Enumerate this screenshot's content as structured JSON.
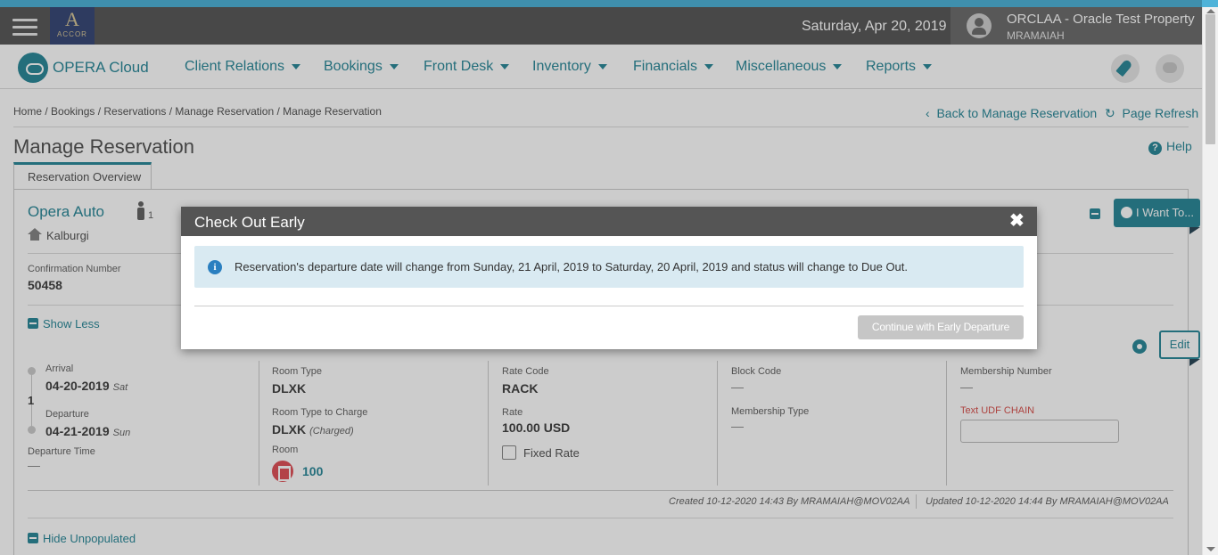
{
  "header": {
    "brand_logo_letter": "A",
    "brand_logo_text": "ACCOR",
    "date": "Saturday, Apr 20, 2019",
    "property_name": "ORCLAA - Oracle Test Property",
    "user": "MRAMAIAH"
  },
  "nav": {
    "app_name": "OPERA Cloud",
    "items": [
      "Client Relations",
      "Bookings",
      "Front Desk",
      "Inventory",
      "Financials",
      "Miscellaneous",
      "Reports"
    ]
  },
  "breadcrumb": "Home / Bookings / Reservations / Manage Reservation / Manage Reservation",
  "links": {
    "back": "Back to Manage Reservation",
    "refresh": "Page Refresh",
    "help": "Help"
  },
  "page_title": "Manage Reservation",
  "tab_label": "Reservation Overview",
  "guest": {
    "name": "Opera Auto",
    "persons": "1",
    "city": "Kalburgi"
  },
  "confirmation": {
    "label": "Confirmation Number",
    "value": "50458"
  },
  "toggles": {
    "show_less": "Show Less",
    "hide_unpopulated": "Hide Unpopulated"
  },
  "buttons": {
    "i_want_to": "I Want To...",
    "edit": "Edit"
  },
  "stay": {
    "arrival_label": "Arrival",
    "arrival_date": "04-20-2019",
    "arrival_day": "Sat",
    "nights": "1",
    "departure_label": "Departure",
    "departure_date": "04-21-2019",
    "departure_day": "Sun",
    "departure_time_label": "Departure Time",
    "departure_time": "—"
  },
  "room": {
    "type_label": "Room Type",
    "type": "DLXK",
    "type_to_charge_label": "Room Type to Charge",
    "type_to_charge": "DLXK",
    "charged": "(Charged)",
    "room_label": "Room",
    "room_number": "100"
  },
  "rate": {
    "code_label": "Rate Code",
    "code": "RACK",
    "rate_label": "Rate",
    "rate": "100.00 USD",
    "fixed_rate_label": "Fixed Rate"
  },
  "block": {
    "code_label": "Block Code",
    "code": "—",
    "membership_type_label": "Membership Type",
    "membership_type": "—"
  },
  "membership": {
    "number_label": "Membership Number",
    "number": "—",
    "udf_label": "Text UDF CHAIN"
  },
  "audit": {
    "created": "Created 10-12-2020 14:43 By MRAMAIAH@MOV02AA",
    "updated": "Updated 10-12-2020 14:44 By MRAMAIAH@MOV02AA"
  },
  "modal": {
    "title": "Check Out Early",
    "close": "✖",
    "message": "Reservation's departure date will change from Sunday, 21 April, 2019 to Saturday, 20 April, 2019 and status will change to Due Out.",
    "continue_label": "Continue with Early Departure"
  }
}
